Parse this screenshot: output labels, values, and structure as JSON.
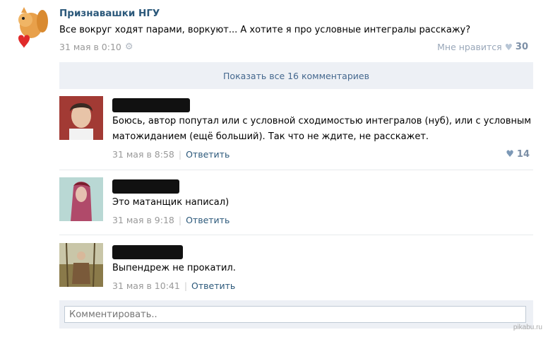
{
  "post": {
    "author": "Признавашки НГУ",
    "text": "Все вокруг ходят парами, воркуют... А хотите я про условные интегралы расскажу?",
    "date": "31 мая в 0:10",
    "like_label": "Мне нравится",
    "like_count": "30"
  },
  "show_all_label": "Показать все 16 комментариев",
  "comments": [
    {
      "text_line1": "Боюсь, автор попутал или с условной сходимостью интегралов (нуб), или с условным",
      "text_line2": "матожиданием (ещё больший). Так что не ждите, не расскажет.",
      "date": "31 мая в 8:58",
      "reply_label": "Ответить",
      "like_count": "14"
    },
    {
      "text_line1": "Это матанщик написал)",
      "date": "31 мая в 9:18",
      "reply_label": "Ответить"
    },
    {
      "text_line1": "Выпендреж не прокатил.",
      "date": "31 мая в 10:41",
      "reply_label": "Ответить"
    }
  ],
  "comment_placeholder": "Комментировать..",
  "watermark": "pikabu.ru",
  "colors": {
    "link": "#2b587a",
    "panel": "#edf0f5",
    "meta": "#999999"
  }
}
